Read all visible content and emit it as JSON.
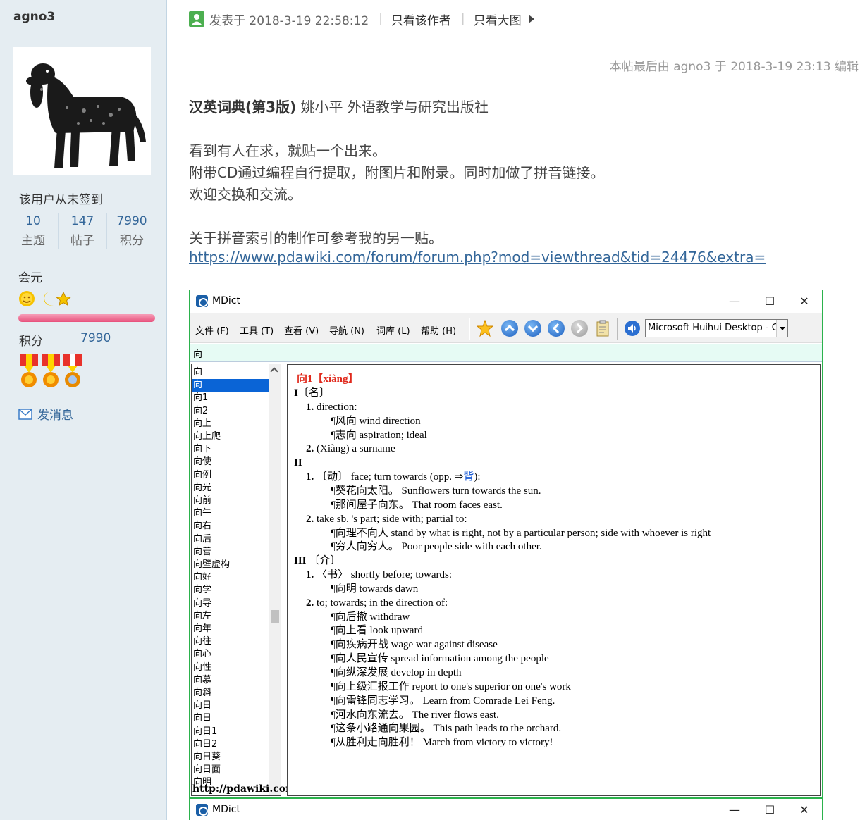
{
  "user": {
    "name": "agno3",
    "signin_status": "该用户从未签到",
    "stats": [
      {
        "num": "10",
        "label": "主题"
      },
      {
        "num": "147",
        "label": "帖子"
      },
      {
        "num": "7990",
        "label": "积分"
      }
    ],
    "group": "会元",
    "points_label": "积分",
    "points_value": "7990",
    "send_message": "发消息"
  },
  "post": {
    "posted_at": "发表于 2018-3-19 22:58:12",
    "only_author": "只看该作者",
    "only_images": "只看大图",
    "edit_note": "本帖最后由 agno3 于 2018-3-19 23:13 编辑",
    "book_title_bold": "汉英词典(第3版)",
    "book_title_rest": " 姚小平 外语教学与研究出版社",
    "lines": [
      "看到有人在求，就贴一个出来。",
      "附带CD通过编程自行提取，附图片和附录。同时加做了拼音链接。",
      "欢迎交换和交流。",
      "关于拼音索引的制作可参考我的另一贴。"
    ],
    "link": "https://www.pdawiki.com/forum/forum.php?mod=viewthread&tid=24476&extra="
  },
  "mdict": {
    "title": "MDict",
    "window_buttons": {
      "minimize": "—",
      "maximize": "☐",
      "close": "✕"
    },
    "menus": [
      "文件 (F)",
      "工具 (T)",
      "查看 (V)",
      "导航 (N)",
      "词库 (L)",
      "帮助 (H)"
    ],
    "font_select": "Microsoft Huihui Desktop - C",
    "search_value": "向",
    "word_list": [
      "向",
      "向",
      "向1",
      "向2",
      "向上",
      "向上爬",
      "向下",
      "向使",
      "向例",
      "向光",
      "向前",
      "向午",
      "向右",
      "向后",
      "向善",
      "向壁虚构",
      "向好",
      "向学",
      "向导",
      "向左",
      "向年",
      "向往",
      "向心",
      "向性",
      "向慕",
      "向斜",
      "向日",
      "向日",
      "向日1",
      "向日2",
      "向日葵",
      "向日面",
      "向明"
    ],
    "selected_index": 1,
    "watermark": "http://pdawiki.com",
    "definition": {
      "headword": "向1【xiàng】",
      "lines": [
        {
          "indent": 0,
          "bold": "I",
          "text": "〔名〕"
        },
        {
          "indent": 1,
          "bold": "1.",
          "text": " direction:"
        },
        {
          "indent": 2,
          "text": "¶风向 wind direction"
        },
        {
          "indent": 2,
          "text": "¶志向 aspiration; ideal"
        },
        {
          "indent": 1,
          "bold": "2.",
          "text": " (Xiàng) a surname"
        },
        {
          "indent": 0,
          "bold": "II",
          "text": ""
        },
        {
          "indent": 1,
          "bold": "1.",
          "text": " 〔动〕 face; turn towards (opp. ⇒",
          "xref": "背",
          "tail": "):"
        },
        {
          "indent": 2,
          "text": "¶葵花向太阳。 Sunflowers turn towards the sun."
        },
        {
          "indent": 2,
          "text": "¶那间屋子向东。 That room faces east."
        },
        {
          "indent": 1,
          "bold": "2.",
          "text": " take sb. 's part; side with; partial to:"
        },
        {
          "indent": 2,
          "text": "¶向理不向人 stand by what is right, not by a particular person; side with whoever is right"
        },
        {
          "indent": 2,
          "text": "¶穷人向穷人。 Poor people side with each other."
        },
        {
          "indent": 0,
          "bold": "III",
          "text": " 〔介〕"
        },
        {
          "indent": 1,
          "bold": "1.",
          "text": " 〈书〉 shortly before; towards:"
        },
        {
          "indent": 2,
          "text": "¶向明 towards dawn"
        },
        {
          "indent": 1,
          "bold": "2.",
          "text": " to; towards; in the direction of:"
        },
        {
          "indent": 2,
          "text": "¶向后撤 withdraw"
        },
        {
          "indent": 2,
          "text": "¶向上看 look upward"
        },
        {
          "indent": 2,
          "text": "¶向疾病开战 wage war against disease"
        },
        {
          "indent": 2,
          "text": "¶向人民宣传 spread information among the people"
        },
        {
          "indent": 2,
          "text": "¶向纵深发展 develop in depth"
        },
        {
          "indent": 2,
          "text": "¶向上级汇报工作 report to one's superior on one's work"
        },
        {
          "indent": 2,
          "text": "¶向雷锋同志学习。 Learn from Comrade Lei Feng."
        },
        {
          "indent": 2,
          "text": "¶河水向东流去。 The river flows east."
        },
        {
          "indent": 2,
          "text": "¶这条小路通向果园。 This path leads to the orchard."
        },
        {
          "indent": 2,
          "text": "¶从胜利走向胜利！ March from victory to victory!"
        }
      ]
    }
  },
  "colors": {
    "accent_link": "#336699",
    "headword": "#e0291c",
    "window_border": "#2bb24c"
  }
}
